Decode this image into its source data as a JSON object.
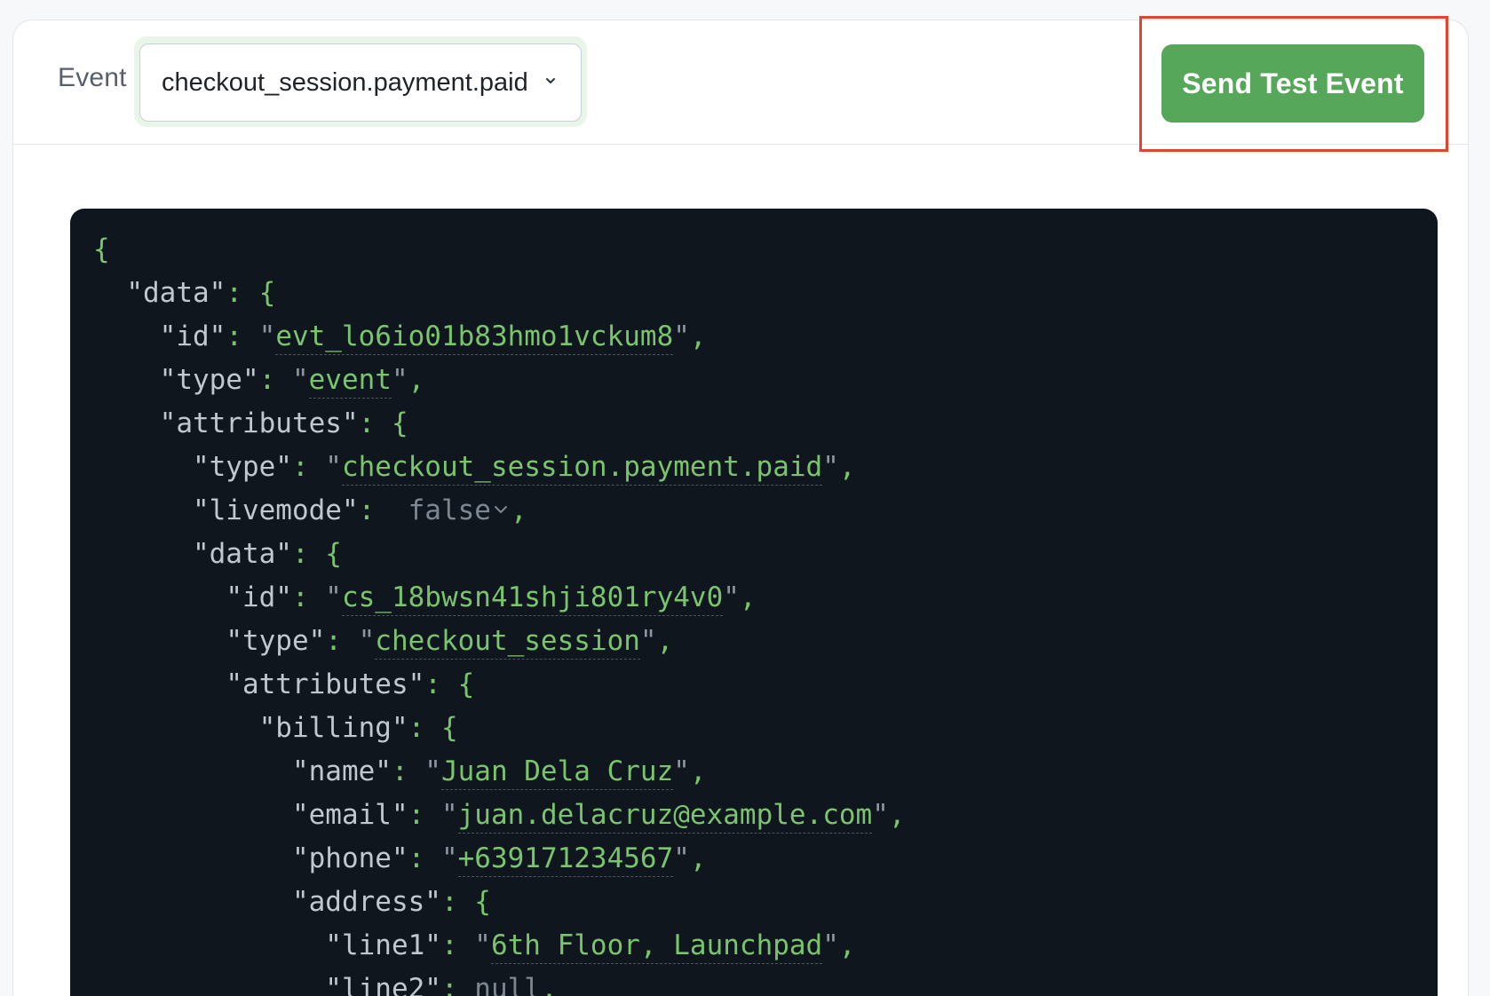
{
  "toolbar": {
    "event_label": "Event",
    "event_select_value": "checkout_session.payment.paid",
    "send_button_label": "Send Test Event"
  },
  "colors": {
    "accent_green": "#56a75a",
    "highlight_red": "#e2452f",
    "code_background": "#0f161e"
  },
  "payload": {
    "data_id": "evt_lo6io01b83hmo1vckum8",
    "data_type": "event",
    "attr_type": "checkout_session.payment.paid",
    "livemode": "false",
    "inner_id": "cs_18bwsn41shji801ry4v0",
    "inner_type": "checkout_session",
    "billing_name": "Juan Dela Cruz",
    "billing_email": "juan.delacruz@example.com",
    "billing_phone": "+639171234567",
    "address_line1": "6th Floor, Launchpad",
    "address_line2": "null"
  },
  "icons": {
    "select_chevron": "chevron-down-icon",
    "boolean_chevron": "chevron-down-icon"
  }
}
